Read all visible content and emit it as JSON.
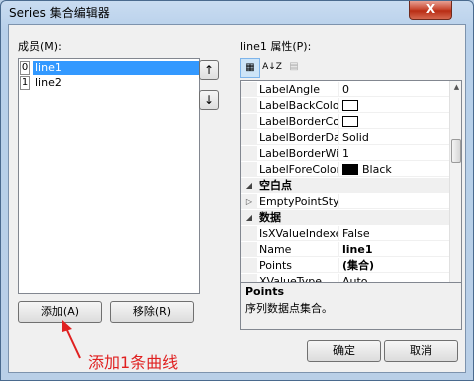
{
  "window": {
    "title": "Series 集合编辑器",
    "close": "X"
  },
  "members": {
    "label": "成员(M):",
    "items": [
      {
        "index": "0",
        "name": "line1",
        "selected": true
      },
      {
        "index": "1",
        "name": "line2",
        "selected": false
      }
    ],
    "move_up": "↑",
    "move_down": "↓",
    "add_label": "添加(A)",
    "remove_label": "移除(R)"
  },
  "properties": {
    "label": "line1 属性(P):",
    "toolbar": {
      "categorized": "▦",
      "alphabetical": "A↓Z",
      "pages": "▤"
    },
    "rows": [
      {
        "kind": "prop",
        "name": "LabelAngle",
        "value": "0"
      },
      {
        "kind": "prop",
        "name": "LabelBackColor",
        "value": "",
        "swatch": "#ffffff"
      },
      {
        "kind": "prop",
        "name": "LabelBorderColo",
        "value": "",
        "swatch": "#ffffff"
      },
      {
        "kind": "prop",
        "name": "LabelBorderDash",
        "value": "Solid"
      },
      {
        "kind": "prop",
        "name": "LabelBorderWidt",
        "value": "1"
      },
      {
        "kind": "prop",
        "name": "LabelForeColor",
        "value": "Black",
        "swatch": "#000000"
      },
      {
        "kind": "cat",
        "name": "空白点",
        "expander": "◢"
      },
      {
        "kind": "prop",
        "name": "EmptyPointStyle",
        "value": "",
        "expander": "▷"
      },
      {
        "kind": "cat",
        "name": "数据",
        "expander": "◢"
      },
      {
        "kind": "prop",
        "name": "IsXValueIndexed",
        "value": "False"
      },
      {
        "kind": "prop",
        "name": "Name",
        "value": "line1",
        "bold": true
      },
      {
        "kind": "prop",
        "name": "Points",
        "value": "(集合)",
        "bold": true
      },
      {
        "kind": "prop",
        "name": "XValueType",
        "value": "Auto"
      }
    ],
    "description": {
      "title": "Points",
      "text": "序列数据点集合。"
    }
  },
  "buttons": {
    "ok": "确定",
    "cancel": "取消"
  },
  "annotation": {
    "text": "添加1条曲线",
    "color": "#e02020"
  }
}
